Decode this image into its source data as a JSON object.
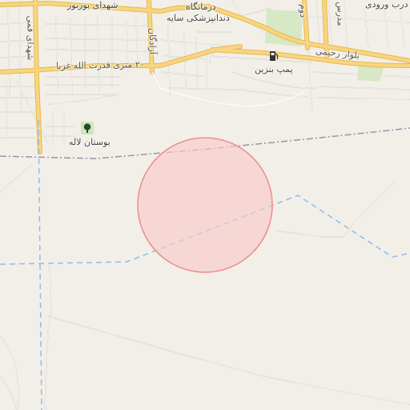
{
  "map": {
    "colors": {
      "land": "#f2efe9",
      "major_road": "#f8d57e",
      "major_road_casing": "#e7b84d",
      "minor_road": "#ffffff",
      "minor_road_casing": "#c8c4bc",
      "park": "#d6e8c4",
      "water_dashed": "#8fbce8",
      "boundary": "#9a93a8",
      "highlight_fill": "#f8c9c9",
      "highlight_stroke": "#ee8c8c"
    },
    "highlight": {
      "shape": "circle"
    },
    "labels": {
      "shohada_bourbour": "شهدای بوربور",
      "darmangah": "درمانگاه",
      "dandanpezeshki_sayeh": "دندانپزشکی سایه",
      "darb_vorudi": "درب ورودی",
      "bolvar_rahimi": "بلوار رحیمی",
      "pomp_benzin": "پمپ بنزین",
      "metri_20": "۲۰ متری قدرت الله غزبا",
      "shohadaye_gomi": "شهدای قمی",
      "azadegan": "آزادگان",
      "boostan_laleh": "بوستان لاله",
      "modares": "مدرس",
      "dovom": "دوم"
    },
    "icons": {
      "fuel": "fuel-icon",
      "park": "tree-icon"
    }
  }
}
